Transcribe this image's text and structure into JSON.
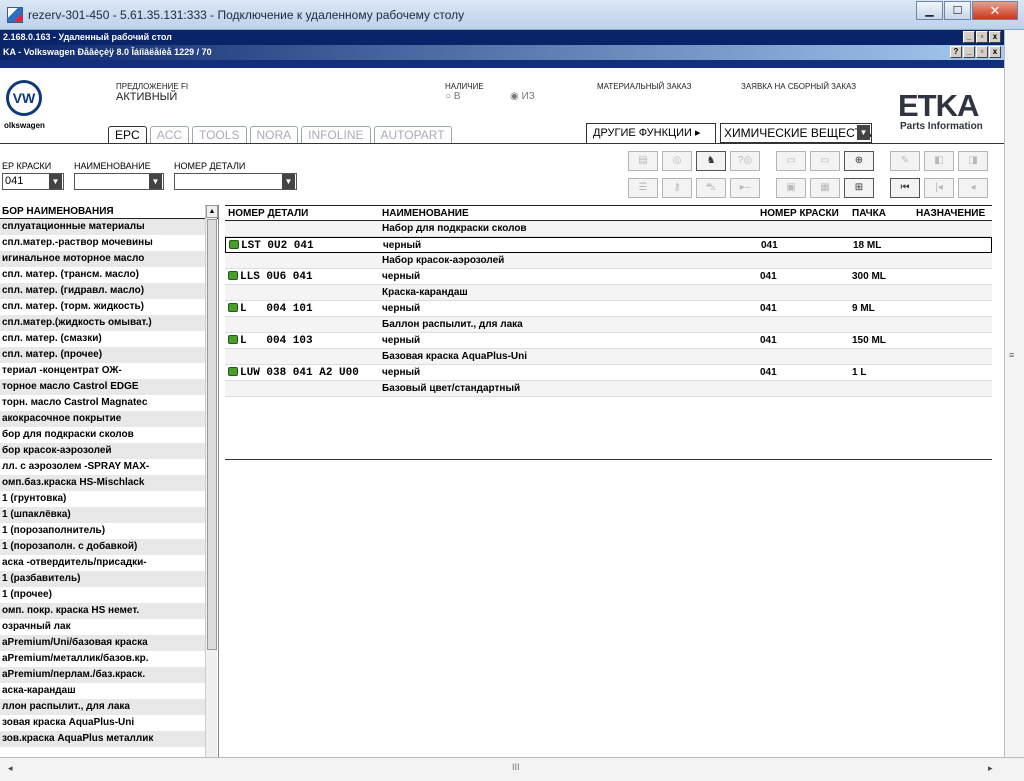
{
  "window": {
    "title": "rezerv-301-450 - 5.61.35.131:333 - Подключение к удаленному рабочему столу",
    "min": "▁",
    "max": "☐",
    "close": "✕"
  },
  "rdp_bar": {
    "text": "2.168.0.163 - Удаленный рабочий стол"
  },
  "etka_window": {
    "title": "KA - Volkswagen Ðåãèçèÿ 8.0 Îáíîâëåíèå 1229 / 70"
  },
  "header": {
    "brand": "olkswagen",
    "brand_logo": "VW",
    "offer_label": "ПРЕДЛОЖЕНИЕ FI",
    "offer_value": "АКТИВНЫЙ",
    "stock_label": "НАЛИЧИЕ",
    "stock_in": "○ В",
    "stock_out": "◉ ИЗ",
    "material_order": "МАТЕРИАЛЬНЫЙ ЗАКАЗ",
    "assembly_order": "ЗАЯВКА НА СБОРНЫЙ ЗАКАЗ",
    "etka_logo": "ETKA",
    "etka_sub": "Parts Information"
  },
  "tabs": [
    "EPC",
    "ACC",
    "TOOLS",
    "NORA",
    "INFOLINE",
    "AUTOPART"
  ],
  "other_functions": {
    "label": "ДРУГИЕ ФУНКЦИИ ▸",
    "selected": "ХИМИЧЕСКИЕ ВЕЩЕСТВА"
  },
  "filters": {
    "color_label": "ЕР КРАСКИ",
    "color_value": "041",
    "name_label": "НАИМЕНОВАНИЕ",
    "name_value": "",
    "part_label": "НОМЕР ДЕТАЛИ",
    "part_value": ""
  },
  "toolbar_icons": [
    "print",
    "globe",
    "horse",
    "sync",
    "elsa",
    "depot",
    "cart-add",
    "pin",
    "doc-prev",
    "doc-next",
    "list",
    "key",
    "car",
    "play-minus",
    "parts",
    "parts-add",
    "cart",
    "first",
    "prev",
    "back"
  ],
  "left_panel": {
    "header": "БОР НАИМЕНОВАНИЯ",
    "items": [
      "сплуатационные материалы",
      "спл.матер.-раствор мочевины",
      "игинальное моторное масло",
      "спл. матер. (трансм. масло)",
      "спл. матер. (гидравл. масло)",
      "спл. матер. (торм. жидкость)",
      "спл.матер.(жидкость омыват.)",
      "спл. матер. (смазки)",
      "спл. матер. (прочее)",
      "териал -концентрат ОЖ-",
      "торное масло Castrol EDGE",
      "торн. масло Castrol Magnatec",
      "акокрасочное покрытие",
      "бор для подкраски сколов",
      "бор красок-аэрозолей",
      "лл. с аэрозолем  -SPRAY MAX-",
      "омп.баз.краска HS-Mischlack",
      "1 (грунтовка)",
      "1 (шпаклёвка)",
      "1 (порозаполнитель)",
      "1 (порозаполн. с добавкой)",
      "аска -отвердитель/присадки-",
      "1 (разбавитель)",
      "1 (прочее)",
      "омп. покр. краска HS немет.",
      "озрачный лак",
      "aPremium/Uni/базовая краска",
      "aPremium/металлик/базов.кр.",
      "aPremium/перлам./баз.краск.",
      "аска-карандаш",
      "ллон распылит., для лака",
      "зовая краска AquaPlus-Uni",
      "зов.краска AquaPlus металлик"
    ]
  },
  "table": {
    "columns": [
      "НОМЕР ДЕТАЛИ",
      "НАИМЕНОВАНИЕ",
      "НОМЕР КРАСКИ",
      "ПАЧКА",
      "НАЗНАЧЕНИЕ"
    ],
    "rows": [
      {
        "type": "group",
        "name": "Набор для подкраски сколов"
      },
      {
        "type": "item",
        "part": "LST 0U2 041",
        "name": "черный",
        "color": "041",
        "pack": "18 ML",
        "selected": true
      },
      {
        "type": "group",
        "name": "Набор красок-аэрозолей"
      },
      {
        "type": "item",
        "part": "LLS 0U6 041",
        "name": "черный",
        "color": "041",
        "pack": "300 ML"
      },
      {
        "type": "group",
        "name": "Краска-карандаш"
      },
      {
        "type": "item",
        "part": "L   004 101",
        "name": "черный",
        "color": "041",
        "pack": "9 ML"
      },
      {
        "type": "group",
        "name": "Баллон распылит., для лака"
      },
      {
        "type": "item",
        "part": "L   004 103",
        "name": "черный",
        "color": "041",
        "pack": "150 ML"
      },
      {
        "type": "group",
        "name": "Базовая краска AquaPlus-Uni"
      },
      {
        "type": "item",
        "part": "LUW 038 041 A2 U00",
        "name": "черный",
        "color": "041",
        "pack": "1 L"
      },
      {
        "type": "group",
        "name": "Базовый цвет/стандартный"
      }
    ]
  },
  "scroll": {
    "left": "◂",
    "right": "▸",
    "grip": "III",
    "vgrip": "≡"
  }
}
